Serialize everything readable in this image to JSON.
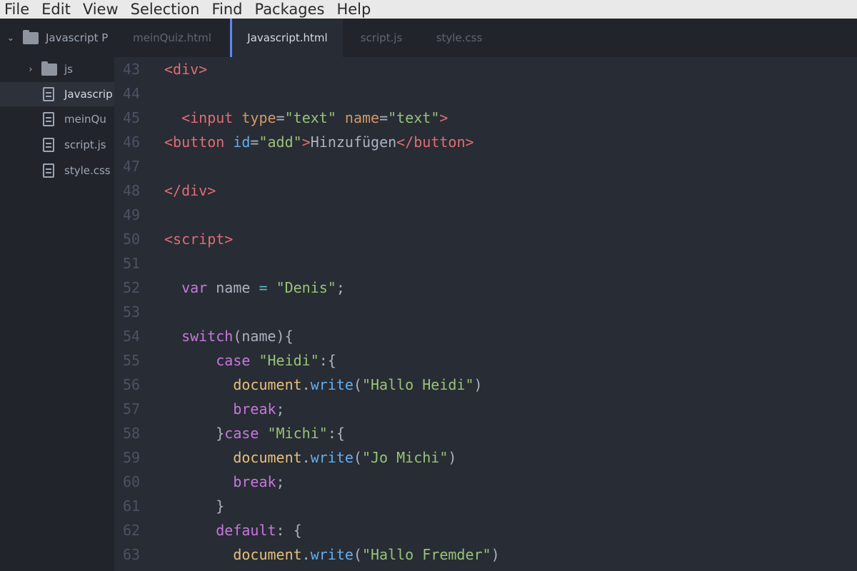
{
  "menu": [
    "File",
    "Edit",
    "View",
    "Selection",
    "Find",
    "Packages",
    "Help"
  ],
  "tree": {
    "project": "Javascript P",
    "folder": "js",
    "files": [
      "Javascrip",
      "meinQu",
      "script.js",
      "style.css"
    ]
  },
  "tabs": [
    "meinQuiz.html",
    "Javascript.html",
    "script.js",
    "style.css"
  ],
  "active_tab": "Javascript.html",
  "lines": [
    {
      "n": "43",
      "tokens": [
        [
          "tag",
          "<div>"
        ]
      ]
    },
    {
      "n": "44",
      "tokens": []
    },
    {
      "n": "45",
      "tokens": [
        [
          "punct",
          "  "
        ],
        [
          "tag",
          "<input "
        ],
        [
          "attr",
          "type"
        ],
        [
          "punct",
          "="
        ],
        [
          "str",
          "\"text\""
        ],
        [
          "punct",
          " "
        ],
        [
          "attr",
          "name"
        ],
        [
          "punct",
          "="
        ],
        [
          "str",
          "\"text\""
        ],
        [
          "tag",
          ">"
        ]
      ]
    },
    {
      "n": "46",
      "tokens": [
        [
          "tag",
          "<button "
        ],
        [
          "fn",
          "id"
        ],
        [
          "punct",
          "="
        ],
        [
          "str",
          "\"add\""
        ],
        [
          "tag",
          ">"
        ],
        [
          "punct",
          "Hinzufügen"
        ],
        [
          "tag",
          "</button>"
        ]
      ]
    },
    {
      "n": "47",
      "tokens": []
    },
    {
      "n": "48",
      "tokens": [
        [
          "tag",
          "</div>"
        ]
      ]
    },
    {
      "n": "49",
      "tokens": []
    },
    {
      "n": "50",
      "tokens": [
        [
          "tag",
          "<script>"
        ]
      ]
    },
    {
      "n": "51",
      "tokens": []
    },
    {
      "n": "52",
      "tokens": [
        [
          "punct",
          "  "
        ],
        [
          "kw",
          "var"
        ],
        [
          "punct",
          " name "
        ],
        [
          "op",
          "="
        ],
        [
          "punct",
          " "
        ],
        [
          "str",
          "\"Denis\""
        ],
        [
          "punct",
          ";"
        ]
      ]
    },
    {
      "n": "53",
      "tokens": []
    },
    {
      "n": "54",
      "tokens": [
        [
          "punct",
          "  "
        ],
        [
          "kw",
          "switch"
        ],
        [
          "punct",
          "(name){"
        ]
      ]
    },
    {
      "n": "55",
      "tokens": [
        [
          "punct",
          "      "
        ],
        [
          "kw",
          "case"
        ],
        [
          "punct",
          " "
        ],
        [
          "str",
          "\"Heidi\""
        ],
        [
          "punct",
          ":{"
        ]
      ]
    },
    {
      "n": "56",
      "tokens": [
        [
          "punct",
          "        "
        ],
        [
          "obj",
          "document"
        ],
        [
          "punct",
          "."
        ],
        [
          "fn",
          "write"
        ],
        [
          "punct",
          "("
        ],
        [
          "str",
          "\"Hallo Heidi\""
        ],
        [
          "punct",
          ")"
        ]
      ]
    },
    {
      "n": "57",
      "tokens": [
        [
          "punct",
          "        "
        ],
        [
          "kw",
          "break"
        ],
        [
          "punct",
          ";"
        ]
      ]
    },
    {
      "n": "58",
      "tokens": [
        [
          "punct",
          "      }"
        ],
        [
          "kw",
          "case"
        ],
        [
          "punct",
          " "
        ],
        [
          "str",
          "\"Michi\""
        ],
        [
          "punct",
          ":{"
        ]
      ]
    },
    {
      "n": "59",
      "tokens": [
        [
          "punct",
          "        "
        ],
        [
          "obj",
          "document"
        ],
        [
          "punct",
          "."
        ],
        [
          "fn",
          "write"
        ],
        [
          "punct",
          "("
        ],
        [
          "str",
          "\"Jo Michi\""
        ],
        [
          "punct",
          ")"
        ]
      ]
    },
    {
      "n": "60",
      "tokens": [
        [
          "punct",
          "        "
        ],
        [
          "kw",
          "break"
        ],
        [
          "punct",
          ";"
        ]
      ]
    },
    {
      "n": "61",
      "tokens": [
        [
          "punct",
          "      }"
        ]
      ]
    },
    {
      "n": "62",
      "tokens": [
        [
          "punct",
          "      "
        ],
        [
          "kw",
          "default"
        ],
        [
          "punct",
          ": {"
        ]
      ]
    },
    {
      "n": "63",
      "tokens": [
        [
          "punct",
          "        "
        ],
        [
          "obj",
          "document"
        ],
        [
          "punct",
          "."
        ],
        [
          "fn",
          "write"
        ],
        [
          "punct",
          "("
        ],
        [
          "str",
          "\"Hallo Fremder\""
        ],
        [
          "punct",
          ")"
        ]
      ]
    }
  ]
}
